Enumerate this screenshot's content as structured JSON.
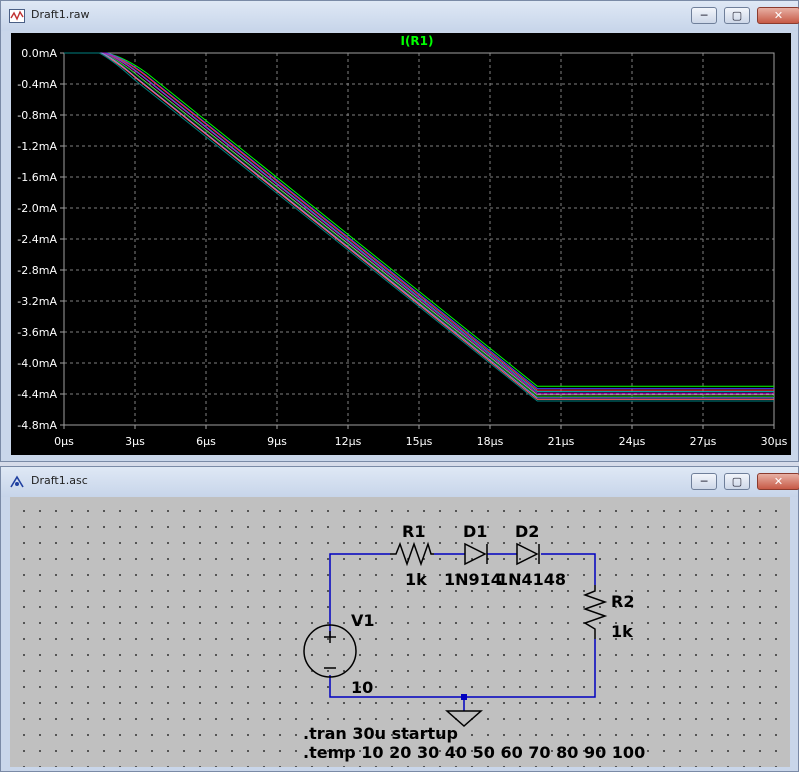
{
  "waveform_window": {
    "title": "Draft1.raw",
    "buttons": {
      "minimize": "─",
      "maximize": "▢",
      "close": "✕"
    }
  },
  "schematic_window": {
    "title": "Draft1.asc",
    "buttons": {
      "minimize": "─",
      "maximize": "▢",
      "close": "✕"
    }
  },
  "chart_data": {
    "type": "line",
    "title": "I(R1)",
    "title_color": "#00ff00",
    "background": "#000000",
    "grid": true,
    "xlabel": "",
    "ylabel": "",
    "x_unit": "µs",
    "y_unit": "mA",
    "xlim": [
      0,
      30
    ],
    "ylim": [
      -4.8,
      0.0
    ],
    "x_ticks": [
      "0µs",
      "3µs",
      "6µs",
      "9µs",
      "12µs",
      "15µs",
      "18µs",
      "21µs",
      "24µs",
      "27µs",
      "30µs"
    ],
    "y_ticks": [
      "0.0mA",
      "-0.4mA",
      "-0.8mA",
      "-1.2mA",
      "-1.6mA",
      "-2.0mA",
      "-2.4mA",
      "-2.8mA",
      "-3.2mA",
      "-3.6mA",
      "-4.0mA",
      "-4.4mA",
      "-4.8mA"
    ],
    "series": [
      {
        "color": "#00ff00",
        "x": [
          0,
          1.8,
          2.6,
          3.5,
          20.0,
          30
        ],
        "y": [
          0,
          0,
          -0.06,
          -0.26,
          -4.3,
          -4.3
        ]
      },
      {
        "color": "#4040ff",
        "x": [
          0,
          1.8,
          2.5,
          3.4,
          20.0,
          30
        ],
        "y": [
          0,
          0,
          -0.06,
          -0.27,
          -4.33,
          -4.33
        ]
      },
      {
        "color": "#ff3030",
        "x": [
          0,
          1.7,
          2.5,
          3.4,
          20.0,
          30
        ],
        "y": [
          0,
          0,
          -0.07,
          -0.28,
          -4.35,
          -4.35
        ]
      },
      {
        "color": "#00c0c0",
        "x": [
          0,
          1.7,
          2.4,
          3.3,
          20.0,
          30
        ],
        "y": [
          0,
          0,
          -0.07,
          -0.29,
          -4.37,
          -4.37
        ]
      },
      {
        "color": "#c000c0",
        "x": [
          0,
          1.7,
          2.4,
          3.3,
          20.0,
          30
        ],
        "y": [
          0,
          0,
          -0.08,
          -0.3,
          -4.39,
          -4.39
        ]
      },
      {
        "color": "#a0a0a0",
        "x": [
          0,
          1.6,
          2.3,
          3.2,
          20.0,
          30
        ],
        "y": [
          0,
          0,
          -0.08,
          -0.31,
          -4.41,
          -4.41
        ]
      },
      {
        "color": "#00a000",
        "x": [
          0,
          1.6,
          2.3,
          3.2,
          20.0,
          30
        ],
        "y": [
          0,
          0,
          -0.09,
          -0.32,
          -4.43,
          -4.43
        ]
      },
      {
        "color": "#8080ff",
        "x": [
          0,
          1.6,
          2.2,
          3.1,
          20.0,
          30
        ],
        "y": [
          0,
          0,
          -0.09,
          -0.33,
          -4.45,
          -4.45
        ]
      },
      {
        "color": "#ff6060",
        "x": [
          0,
          1.5,
          2.2,
          3.1,
          20.0,
          30
        ],
        "y": [
          0,
          0,
          -0.1,
          -0.34,
          -4.47,
          -4.47
        ]
      },
      {
        "color": "#008080",
        "x": [
          0,
          1.5,
          2.1,
          3.0,
          20.0,
          30
        ],
        "y": [
          0,
          0,
          -0.1,
          -0.35,
          -4.49,
          -4.49
        ]
      }
    ]
  },
  "schematic": {
    "r1": {
      "name": "R1",
      "value": "1k"
    },
    "d1": {
      "name": "D1",
      "value": "1N914"
    },
    "d2": {
      "name": "D2",
      "value": "1N4148"
    },
    "r2": {
      "name": "R2",
      "value": "1k"
    },
    "v1": {
      "name": "V1",
      "value": "10"
    },
    "directives": [
      ".tran 30u startup",
      ".temp 10 20 30 40 50 60 70 80 90 100"
    ]
  },
  "colors": {
    "wire": "#0000c0",
    "component": "#000000",
    "label": "#000000",
    "plot_bg": "#000000",
    "schematic_bg": "#c0c0c0"
  }
}
